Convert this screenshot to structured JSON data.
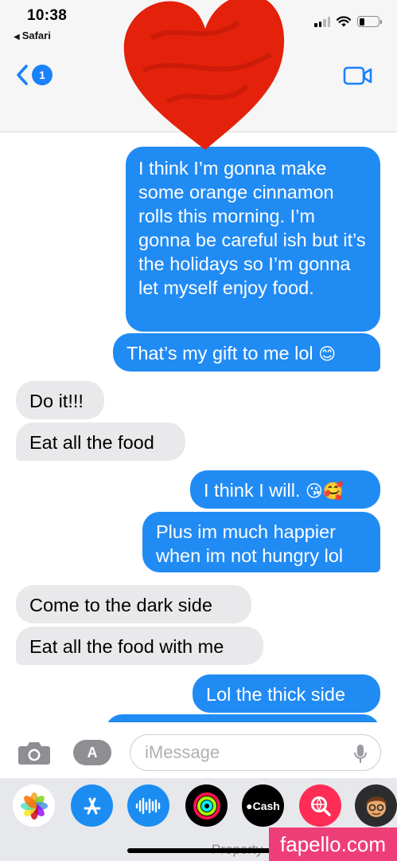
{
  "status_bar": {
    "time": "10:38",
    "back_app": "Safari"
  },
  "header": {
    "unread_count": "1"
  },
  "messages": [
    {
      "from": "me",
      "text": "I think I’m gonna make some orange cinnamon rolls this morning. I’m gonna be careful ish but it’s the holidays so I’m gonna let myself enjoy food."
    },
    {
      "from": "me",
      "text": "That’s my gift to me lol",
      "emoji": "😊"
    },
    {
      "from": "them",
      "text": "Do it!!!"
    },
    {
      "from": "them",
      "text": "Eat all the food"
    },
    {
      "from": "me",
      "text": "I think I will.",
      "emoji": "😘🥰"
    },
    {
      "from": "me",
      "text": "Plus im much happier when im not hungry lol"
    },
    {
      "from": "them",
      "text": "Come to the dark side"
    },
    {
      "from": "them",
      "text": "Eat all the food with me"
    },
    {
      "from": "me",
      "text": "Lol the thick side"
    }
  ],
  "compose": {
    "placeholder": "iMessage"
  },
  "app_drawer": {
    "apps": [
      "photos-icon",
      "app-store-icon",
      "audio-message-icon",
      "activity-icon",
      "apple-cash-icon",
      "image-search-icon",
      "memoji-icon"
    ],
    "cash_label": "Cash"
  },
  "footer": {
    "partial_text": "Property",
    "watermark": "fapello.com"
  },
  "colors": {
    "sent": "#218bf4",
    "received": "#e9e9eb",
    "accent": "#1a82fb"
  }
}
